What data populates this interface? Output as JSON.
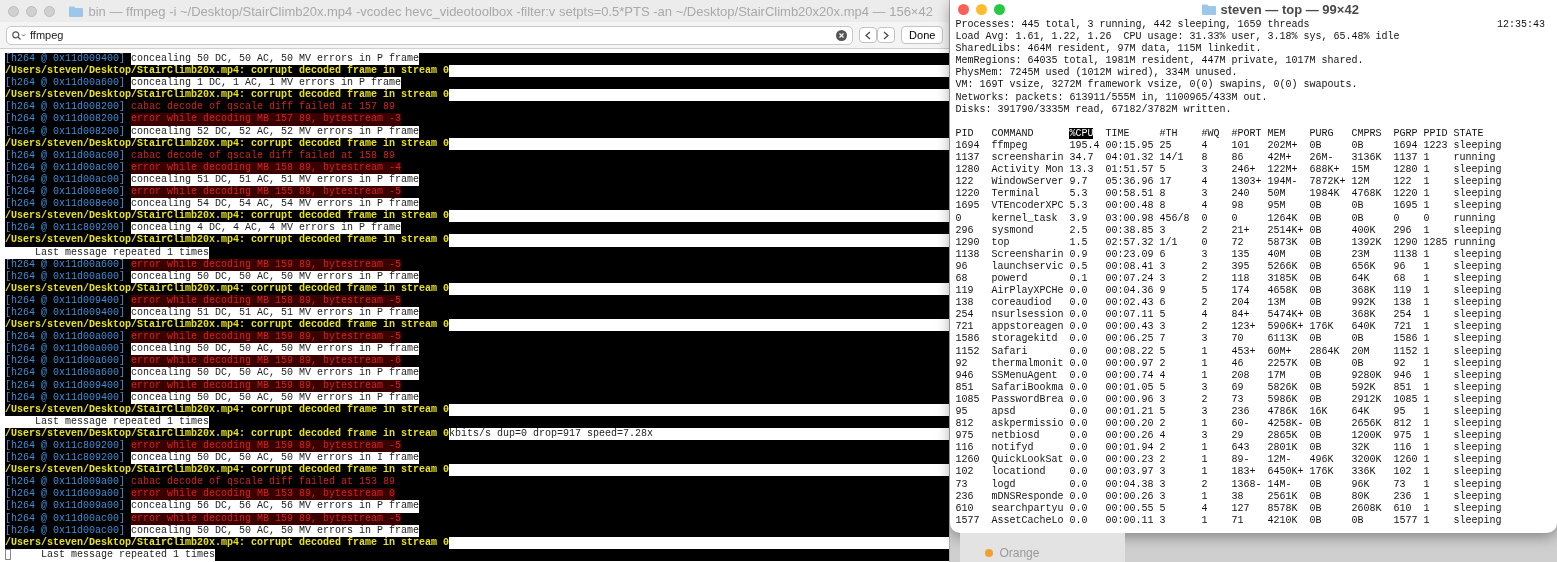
{
  "terminal": {
    "title": "bin — ffmpeg -i ~/Desktop/StairClimb20x.mp4 -vcodec hevc_videotoolbox -filter:v setpts=0.5*PTS -an ~/Desktop/StairClimb20x20x.mp4 — 156×42",
    "find": {
      "value": "ffmpeg",
      "buttons": [
        "Done"
      ]
    },
    "lines": [
      {
        "kind": "conceal",
        "prefix": "[h264 @ 0x11d009400]",
        "text": "concealing 50 DC, 50 AC, 50 MV errors in P frame"
      },
      {
        "kind": "path",
        "text": "/Users/steven/Desktop/StairClimb20x.mp4: corrupt decoded frame in stream 0"
      },
      {
        "kind": "conceal",
        "prefix": "[h264 @ 0x11d00a600]",
        "text": "concealing 1 DC, 1 AC, 1 MV errors in P frame"
      },
      {
        "kind": "path",
        "text": "/Users/steven/Desktop/StairClimb20x.mp4: corrupt decoded frame in stream 0"
      },
      {
        "kind": "cabac",
        "prefix": "[h264 @ 0x11d008200]",
        "text": "cabac decode of qscale diff failed at 157 89"
      },
      {
        "kind": "error",
        "prefix": "[h264 @ 0x11d008200]",
        "text": "error while decoding MB 157 89, bytestream -3"
      },
      {
        "kind": "conceal",
        "prefix": "[h264 @ 0x11d008200]",
        "text": "concealing 52 DC, 52 AC, 52 MV errors in P frame"
      },
      {
        "kind": "path",
        "text": "/Users/steven/Desktop/StairClimb20x.mp4: corrupt decoded frame in stream 0"
      },
      {
        "kind": "cabac",
        "prefix": "[h264 @ 0x11d00ac00]",
        "text": "cabac decode of qscale diff failed at 158 89"
      },
      {
        "kind": "error",
        "prefix": "[h264 @ 0x11d00ac00]",
        "text": "error while decoding MB 158 89, bytestream -4"
      },
      {
        "kind": "conceal",
        "prefix": "[h264 @ 0x11d00ac00]",
        "text": "concealing 51 DC, 51 AC, 51 MV errors in P frame"
      },
      {
        "kind": "error",
        "prefix": "[h264 @ 0x11d008e00]",
        "text": "error while decoding MB 155 89, bytestream -5"
      },
      {
        "kind": "conceal",
        "prefix": "[h264 @ 0x11d008e00]",
        "text": "concealing 54 DC, 54 AC, 54 MV errors in P frame"
      },
      {
        "kind": "path",
        "text": "/Users/steven/Desktop/StairClimb20x.mp4: corrupt decoded frame in stream 0"
      },
      {
        "kind": "conceal",
        "prefix": "[h264 @ 0x11c809200]",
        "text": "concealing 4 DC, 4 AC, 4 MV errors in P frame"
      },
      {
        "kind": "path",
        "text": "/Users/steven/Desktop/StairClimb20x.mp4: corrupt decoded frame in stream 0"
      },
      {
        "kind": "repeat",
        "text": "Last message repeated 1 times"
      },
      {
        "kind": "error",
        "prefix": "[h264 @ 0x11d00a600]",
        "text": "error while decoding MB 159 89, bytestream -5"
      },
      {
        "kind": "conceal",
        "prefix": "[h264 @ 0x11d00a600]",
        "text": "concealing 50 DC, 50 AC, 50 MV errors in P frame"
      },
      {
        "kind": "path",
        "text": "/Users/steven/Desktop/StairClimb20x.mp4: corrupt decoded frame in stream 0"
      },
      {
        "kind": "error",
        "prefix": "[h264 @ 0x11d009400]",
        "text": "error while decoding MB 158 89, bytestream -5"
      },
      {
        "kind": "conceal",
        "prefix": "[h264 @ 0x11d009400]",
        "text": "concealing 51 DC, 51 AC, 51 MV errors in P frame"
      },
      {
        "kind": "path",
        "text": "/Users/steven/Desktop/StairClimb20x.mp4: corrupt decoded frame in stream 0"
      },
      {
        "kind": "error",
        "prefix": "[h264 @ 0x11d00a000]",
        "text": "error while decoding MB 159 89, bytestream -5"
      },
      {
        "kind": "conceal",
        "prefix": "[h264 @ 0x11d00a000]",
        "text": "concealing 50 DC, 50 AC, 50 MV errors in P frame"
      },
      {
        "kind": "error",
        "prefix": "[h264 @ 0x11d00a600]",
        "text": "error while decoding MB 159 89, bytestream -6"
      },
      {
        "kind": "conceal",
        "prefix": "[h264 @ 0x11d00a600]",
        "text": "concealing 50 DC, 50 AC, 50 MV errors in P frame"
      },
      {
        "kind": "error",
        "prefix": "[h264 @ 0x11d009400]",
        "text": "error while decoding MB 159 89, bytestream -5"
      },
      {
        "kind": "conceal",
        "prefix": "[h264 @ 0x11d009400]",
        "text": "concealing 50 DC, 50 AC, 50 MV errors in P frame"
      },
      {
        "kind": "path",
        "text": "/Users/steven/Desktop/StairClimb20x.mp4: corrupt decoded frame in stream 0"
      },
      {
        "kind": "repeat",
        "text": "Last message repeated 1 times"
      },
      {
        "kind": "path",
        "text": "/Users/steven/Desktop/StairClimb20x.mp4: corrupt decoded frame in stream 0",
        "suffix": "kbits/s dup=0 drop=917 speed=7.28x"
      },
      {
        "kind": "error",
        "prefix": "[h264 @ 0x11c809200]",
        "text": "error while decoding MB 159 89, bytestream -5"
      },
      {
        "kind": "conceal",
        "prefix": "[h264 @ 0x11c809200]",
        "text": "concealing 50 DC, 50 AC, 50 MV errors in I frame"
      },
      {
        "kind": "path",
        "text": "/Users/steven/Desktop/StairClimb20x.mp4: corrupt decoded frame in stream 0"
      },
      {
        "kind": "cabac",
        "prefix": "[h264 @ 0x11d009a00]",
        "text": "cabac decode of qscale diff failed at 153 89"
      },
      {
        "kind": "error",
        "prefix": "[h264 @ 0x11d009a00]",
        "text": "error while decoding MB 153 89, bytestream 0"
      },
      {
        "kind": "conceal",
        "prefix": "[h264 @ 0x11d009a00]",
        "text": "concealing 56 DC, 56 AC, 56 MV errors in P frame"
      },
      {
        "kind": "error",
        "prefix": "[h264 @ 0x11d00ac00]",
        "text": "error while decoding MB 159 89, bytestream -5"
      },
      {
        "kind": "conceal",
        "prefix": "[h264 @ 0x11d00ac00]",
        "text": "concealing 50 DC, 50 AC, 50 MV errors in P frame"
      },
      {
        "kind": "path",
        "text": "/Users/steven/Desktop/StairClimb20x.mp4: corrupt decoded frame in stream 0"
      },
      {
        "kind": "repeat",
        "text": "Last message repeated 1 times",
        "cursor": true
      }
    ]
  },
  "top_window": {
    "title": "steven — top — 99×42",
    "clock": "12:35:43",
    "summary": [
      "Processes: 445 total, 3 running, 442 sleeping, 1659 threads",
      "Load Avg: 1.61, 1.22, 1.26  CPU usage: 31.33% user, 3.18% sys, 65.48% idle",
      "SharedLibs: 464M resident, 97M data, 115M linkedit.",
      "MemRegions: 64035 total, 1981M resident, 447M private, 1017M shared.",
      "PhysMem: 7245M used (1012M wired), 334M unused.",
      "VM: 169T vsize, 3272M framework vsize, 0(0) swapins, 0(0) swapouts.",
      "Networks: packets: 613911/555M in, 1100965/433M out.",
      "Disks: 391790/3335M read, 67182/3782M written."
    ],
    "columns": [
      {
        "label": "PID",
        "sorted": false
      },
      {
        "label": "COMMAND",
        "sorted": false
      },
      {
        "label": "%CPU",
        "sorted": true
      },
      {
        "label": "TIME",
        "sorted": false
      },
      {
        "label": "#TH",
        "sorted": false
      },
      {
        "label": "#WQ",
        "sorted": false
      },
      {
        "label": "#PORT",
        "sorted": false
      },
      {
        "label": "MEM",
        "sorted": false
      },
      {
        "label": "PURG",
        "sorted": false
      },
      {
        "label": "CMPRS",
        "sorted": false
      },
      {
        "label": "PGRP",
        "sorted": false
      },
      {
        "label": "PPID",
        "sorted": false
      },
      {
        "label": "STATE",
        "sorted": false
      }
    ],
    "rows": [
      [
        "1694",
        "ffmpeg",
        "195.4",
        "00:15.95",
        "25",
        "4",
        "101",
        "202M+",
        "0B",
        "0B",
        "1694",
        "1223",
        "sleeping"
      ],
      [
        "1137",
        "screensharin",
        "34.7",
        "04:01.32",
        "14/1",
        "8",
        "86",
        "42M+",
        "26M-",
        "3136K",
        "1137",
        "1",
        "running"
      ],
      [
        "1280",
        "Activity Mon",
        "13.3",
        "01:51.57",
        "5",
        "3",
        "246+",
        "122M+",
        "688K+",
        "15M",
        "1280",
        "1",
        "sleeping"
      ],
      [
        "122",
        "WindowServer",
        "9.7",
        "05:36.96",
        "17",
        "4",
        "1303+",
        "194M-",
        "7872K+",
        "12M",
        "122",
        "1",
        "sleeping"
      ],
      [
        "1220",
        "Terminal",
        "5.3",
        "00:58.51",
        "8",
        "3",
        "240",
        "50M",
        "1984K",
        "4768K",
        "1220",
        "1",
        "sleeping"
      ],
      [
        "1695",
        "VTEncoderXPC",
        "5.3",
        "00:00.48",
        "8",
        "4",
        "98",
        "95M",
        "0B",
        "0B",
        "1695",
        "1",
        "sleeping"
      ],
      [
        "0",
        "kernel_task",
        "3.9",
        "03:00.98",
        "456/8",
        "0",
        "0",
        "1264K",
        "0B",
        "0B",
        "0",
        "0",
        "running"
      ],
      [
        "296",
        "sysmond",
        "2.5",
        "00:38.85",
        "3",
        "2",
        "21+",
        "2514K+",
        "0B",
        "400K",
        "296",
        "1",
        "sleeping"
      ],
      [
        "1290",
        "top",
        "1.5",
        "02:57.32",
        "1/1",
        "0",
        "72",
        "5873K",
        "0B",
        "1392K",
        "1290",
        "1285",
        "running"
      ],
      [
        "1138",
        "Screensharin",
        "0.9",
        "00:23.09",
        "6",
        "3",
        "135",
        "40M",
        "0B",
        "23M",
        "1138",
        "1",
        "sleeping"
      ],
      [
        "96",
        "launchservic",
        "0.5",
        "00:08.41",
        "3",
        "2",
        "395",
        "5266K",
        "0B",
        "656K",
        "96",
        "1",
        "sleeping"
      ],
      [
        "68",
        "powerd",
        "0.1",
        "00:07.24",
        "3",
        "2",
        "118",
        "3185K",
        "0B",
        "64K",
        "68",
        "1",
        "sleeping"
      ],
      [
        "119",
        "AirPlayXPCHe",
        "0.0",
        "00:04.36",
        "9",
        "5",
        "174",
        "4658K",
        "0B",
        "368K",
        "119",
        "1",
        "sleeping"
      ],
      [
        "138",
        "coreaudiod",
        "0.0",
        "00:02.43",
        "6",
        "2",
        "204",
        "13M",
        "0B",
        "992K",
        "138",
        "1",
        "sleeping"
      ],
      [
        "254",
        "nsurlsession",
        "0.0",
        "00:07.11",
        "5",
        "4",
        "84+",
        "5474K+",
        "0B",
        "368K",
        "254",
        "1",
        "sleeping"
      ],
      [
        "721",
        "appstoreagen",
        "0.0",
        "00:00.43",
        "3",
        "2",
        "123+",
        "5906K+",
        "176K",
        "640K",
        "721",
        "1",
        "sleeping"
      ],
      [
        "1586",
        "storagekitd",
        "0.0",
        "00:06.25",
        "7",
        "3",
        "70",
        "6113K",
        "0B",
        "0B",
        "1586",
        "1",
        "sleeping"
      ],
      [
        "1152",
        "Safari",
        "0.0",
        "00:08.22",
        "5",
        "1",
        "453+",
        "60M+",
        "2864K",
        "20M",
        "1152",
        "1",
        "sleeping"
      ],
      [
        "92",
        "thermalmonit",
        "0.0",
        "00:00.97",
        "2",
        "1",
        "46",
        "2257K",
        "0B",
        "0B",
        "92",
        "1",
        "sleeping"
      ],
      [
        "946",
        "SSMenuAgent",
        "0.0",
        "00:00.74",
        "4",
        "1",
        "208",
        "17M",
        "0B",
        "9280K",
        "946",
        "1",
        "sleeping"
      ],
      [
        "851",
        "SafariBookma",
        "0.0",
        "00:01.05",
        "5",
        "3",
        "69",
        "5826K",
        "0B",
        "592K",
        "851",
        "1",
        "sleeping"
      ],
      [
        "1085",
        "PasswordBrea",
        "0.0",
        "00:00.96",
        "3",
        "2",
        "73",
        "5986K",
        "0B",
        "2912K",
        "1085",
        "1",
        "sleeping"
      ],
      [
        "95",
        "apsd",
        "0.0",
        "00:01.21",
        "5",
        "3",
        "236",
        "4786K",
        "16K",
        "64K",
        "95",
        "1",
        "sleeping"
      ],
      [
        "812",
        "askpermissio",
        "0.0",
        "00:00.20",
        "2",
        "1",
        "60-",
        "4258K-",
        "0B",
        "2656K",
        "812",
        "1",
        "sleeping"
      ],
      [
        "975",
        "netbiosd",
        "0.0",
        "00:00.26",
        "4",
        "3",
        "29",
        "2865K",
        "0B",
        "1200K",
        "975",
        "1",
        "sleeping"
      ],
      [
        "116",
        "notifyd",
        "0.0",
        "00:01.94",
        "2",
        "1",
        "643",
        "2801K",
        "0B",
        "32K",
        "116",
        "1",
        "sleeping"
      ],
      [
        "1260",
        "QuickLookSat",
        "0.0",
        "00:00.23",
        "2",
        "1",
        "89-",
        "12M-",
        "496K",
        "3200K",
        "1260",
        "1",
        "sleeping"
      ],
      [
        "102",
        "locationd",
        "0.0",
        "00:03.97",
        "3",
        "1",
        "183+",
        "6450K+",
        "176K",
        "336K",
        "102",
        "1",
        "sleeping"
      ],
      [
        "73",
        "logd",
        "0.0",
        "00:04.38",
        "3",
        "2",
        "1368-",
        "14M-",
        "0B",
        "96K",
        "73",
        "1",
        "sleeping"
      ],
      [
        "236",
        "mDNSResponde",
        "0.0",
        "00:00.26",
        "3",
        "1",
        "38",
        "2561K",
        "0B",
        "80K",
        "236",
        "1",
        "sleeping"
      ],
      [
        "610",
        "searchpartyu",
        "0.0",
        "00:00.55",
        "5",
        "4",
        "127",
        "8578K",
        "0B",
        "2608K",
        "610",
        "1",
        "sleeping"
      ],
      [
        "1577",
        "AssetCacheLo",
        "0.0",
        "00:00.11",
        "3",
        "1",
        "71",
        "4210K",
        "0B",
        "0B",
        "1577",
        "1",
        "sleeping"
      ]
    ]
  },
  "background_sidebar": {
    "items": [
      {
        "label": "Orange",
        "color": "#f0a030"
      }
    ]
  }
}
